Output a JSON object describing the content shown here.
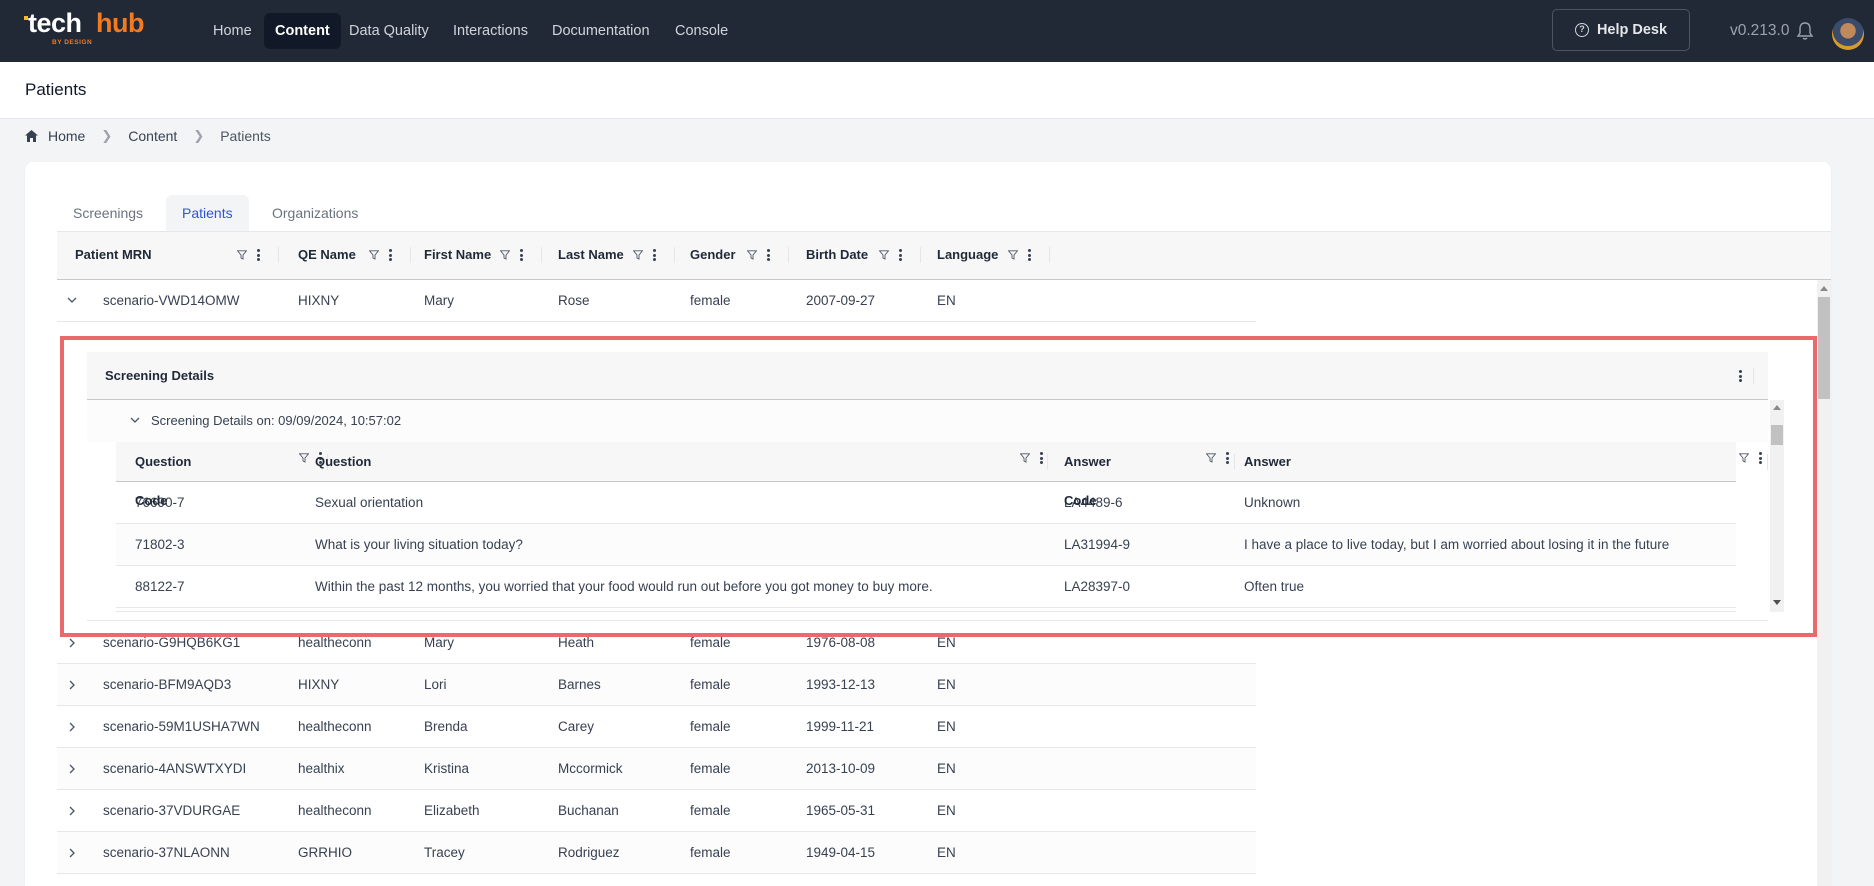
{
  "header": {
    "logo": {
      "word1": "tech",
      "word2": "hub",
      "tagline": "BY DESIGN"
    },
    "nav": [
      {
        "label": "Home",
        "active": false
      },
      {
        "label": "Content",
        "active": true
      },
      {
        "label": "Data Quality",
        "active": false
      },
      {
        "label": "Interactions",
        "active": false
      },
      {
        "label": "Documentation",
        "active": false
      },
      {
        "label": "Console",
        "active": false
      }
    ],
    "help_desk_label": "Help Desk",
    "help_icon": "question-circle-icon",
    "version": "v0.213.0",
    "bell_icon": "bell-icon",
    "avatar": "user-avatar"
  },
  "page": {
    "title": "Patients"
  },
  "breadcrumb": [
    {
      "label": "Home",
      "icon": "home-icon"
    },
    {
      "label": "Content"
    },
    {
      "label": "Patients"
    }
  ],
  "tabs": [
    {
      "label": "Screenings",
      "active": false
    },
    {
      "label": "Patients",
      "active": true
    },
    {
      "label": "Organizations",
      "active": false
    }
  ],
  "grid": {
    "columns": [
      "Patient MRN",
      "QE Name",
      "First Name",
      "Last Name",
      "Gender",
      "Birth Date",
      "Language"
    ],
    "rows": [
      {
        "mrn": "scenario-VWD14OMW",
        "qe": "HIXNY",
        "first": "Mary",
        "last": "Rose",
        "gender": "female",
        "birth": "2007-09-27",
        "lang": "EN",
        "expanded": true
      },
      {
        "mrn": "scenario-G9HQB6KG1",
        "qe": "healtheconn",
        "first": "Mary",
        "last": "Heath",
        "gender": "female",
        "birth": "1976-08-08",
        "lang": "EN",
        "expanded": false
      },
      {
        "mrn": "scenario-BFM9AQD3",
        "qe": "HIXNY",
        "first": "Lori",
        "last": "Barnes",
        "gender": "female",
        "birth": "1993-12-13",
        "lang": "EN",
        "expanded": false
      },
      {
        "mrn": "scenario-59M1USHA7WN",
        "qe": "healtheconn",
        "first": "Brenda",
        "last": "Carey",
        "gender": "female",
        "birth": "1999-11-21",
        "lang": "EN",
        "expanded": false
      },
      {
        "mrn": "scenario-4ANSWTXYDI",
        "qe": "healthix",
        "first": "Kristina",
        "last": "Mccormick",
        "gender": "female",
        "birth": "2013-10-09",
        "lang": "EN",
        "expanded": false
      },
      {
        "mrn": "scenario-37VDURGAE",
        "qe": "healtheconn",
        "first": "Elizabeth",
        "last": "Buchanan",
        "gender": "female",
        "birth": "1965-05-31",
        "lang": "EN",
        "expanded": false
      },
      {
        "mrn": "scenario-37NLAONN",
        "qe": "GRRHIO",
        "first": "Tracey",
        "last": "Rodriguez",
        "gender": "female",
        "birth": "1949-04-15",
        "lang": "EN",
        "expanded": false
      }
    ]
  },
  "detail": {
    "title": "Screening Details",
    "group_label": "Screening Details on: 09/09/2024, 10:57:02",
    "columns": [
      "Question Code",
      "Question",
      "Answer Code",
      "Answer"
    ],
    "rows": [
      {
        "qcode": "76690-7",
        "question": "Sexual orientation",
        "acode": "LA4489-6",
        "answer": "Unknown"
      },
      {
        "qcode": "71802-3",
        "question": "What is your living situation today?",
        "acode": "LA31994-9",
        "answer": "I have a place to live today, but I am worried about losing it in the future"
      },
      {
        "qcode": "88122-7",
        "question": "Within the past 12 months, you worried that your food would run out before you got money to buy more.",
        "acode": "LA28397-0",
        "answer": "Often true"
      }
    ]
  },
  "colors": {
    "header_bg": "#212936",
    "brand_orange": "#f47a20",
    "active_tab": "#2f55d4",
    "highlight_border": "#e86a6a"
  }
}
